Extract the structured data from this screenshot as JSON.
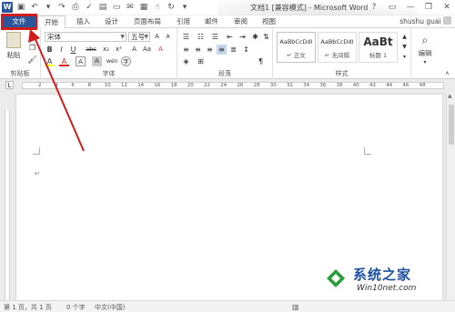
{
  "window": {
    "title": "文档1 [兼容模式] - Microsoft Word",
    "help": "?",
    "controls": {
      "minimize": "—",
      "restore": "❐",
      "close": "✕"
    }
  },
  "qat": {
    "save_icon": "💾",
    "undo_icon": "↶",
    "redo_icon": "↷",
    "more_icon": "▾"
  },
  "tabs": [
    {
      "label": "文件"
    },
    {
      "label": "开始"
    },
    {
      "label": "插入"
    },
    {
      "label": "设计"
    },
    {
      "label": "页面布局"
    },
    {
      "label": "引用"
    },
    {
      "label": "邮件"
    },
    {
      "label": "审阅"
    },
    {
      "label": "视图"
    }
  ],
  "user": {
    "name": "shushu guai"
  },
  "ribbon": {
    "clipboard": {
      "paste": "粘贴",
      "label": "剪贴板"
    },
    "font": {
      "name": "宋体",
      "size": "五号",
      "wen": "wén",
      "label": "字体",
      "bold": "B",
      "italic": "I",
      "underline": "U",
      "strike": "abc",
      "subscript": "x₂",
      "superscript": "x²",
      "grow": "A",
      "shrink": "A",
      "aa": "Aa",
      "clear": "A",
      "border_a": "A",
      "color_a": "A",
      "highlight": "A"
    },
    "paragraph": {
      "label": "段落"
    },
    "styles": {
      "label": "样式",
      "items": [
        {
          "sample": "AaBbCcDdI",
          "name": "↵ 正文"
        },
        {
          "sample": "AaBbCcDdI",
          "name": "↵ 无间隔"
        },
        {
          "sample": "AaBt",
          "name": "标题 1"
        }
      ]
    },
    "editing": {
      "label": "编辑"
    }
  },
  "ruler": {
    "numbers": [
      "2",
      "4",
      "6",
      "8",
      "10",
      "12",
      "14",
      "16",
      "18",
      "20",
      "22",
      "24",
      "26",
      "28",
      "30",
      "32",
      "34",
      "36",
      "38",
      "40",
      "42",
      "44",
      "46",
      "48"
    ]
  },
  "document": {
    "paragraph_mark": "↵"
  },
  "status": {
    "page": "第 1 页，共 1 页",
    "words": "0 个字",
    "lang": "中文(中国)"
  },
  "watermark": {
    "text": "系统之家",
    "url": "Win10net.com"
  },
  "colors": {
    "file_tab": "#2b579a",
    "annotation": "#d21c1c",
    "font_color_red": "#e02020",
    "highlight_yellow": "#ffff00"
  }
}
